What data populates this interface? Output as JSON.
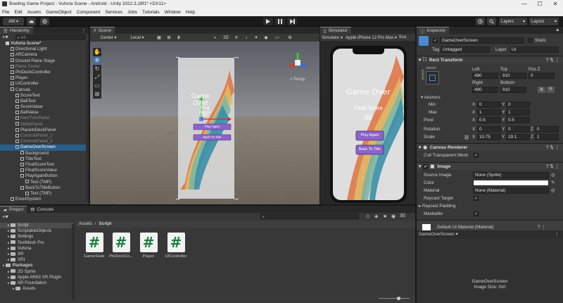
{
  "window": {
    "title": "Bowling Game Project - Vuforia Scene - Android - Unity 2022.3.28f1* <DX11>",
    "controls": [
      "—",
      "☐",
      "✕"
    ]
  },
  "menu": [
    "File",
    "Edit",
    "Assets",
    "GameObject",
    "Component",
    "Services",
    "Jobs",
    "Tutorials",
    "Window",
    "Help"
  ],
  "toolbar": {
    "account": "AW ▾",
    "layers": "Layers",
    "layout": "Layout"
  },
  "hierarchy": {
    "tab": "Hierarchy",
    "search_placeholder": "All",
    "items": [
      {
        "label": "Vuforia Scene*",
        "indent": 0,
        "style": "bold"
      },
      {
        "label": "Directional Light",
        "indent": 1
      },
      {
        "label": "ARCamera",
        "indent": 1
      },
      {
        "label": "Ground Plane Stage",
        "indent": 1
      },
      {
        "label": "Plane Finder",
        "indent": 1,
        "style": "dim"
      },
      {
        "label": "PinDeckController",
        "indent": 1
      },
      {
        "label": "Player",
        "indent": 1
      },
      {
        "label": "UIController",
        "indent": 1
      },
      {
        "label": "Canvas",
        "indent": 1
      },
      {
        "label": "ScoreText",
        "indent": 2
      },
      {
        "label": "BallText",
        "indent": 2
      },
      {
        "label": "ScoreValue",
        "indent": 2
      },
      {
        "label": "BallValue",
        "indent": 2
      },
      {
        "label": "NextTurnPanel",
        "indent": 2,
        "style": "dim"
      },
      {
        "label": "StrikePanel",
        "indent": 2,
        "style": "dim"
      },
      {
        "label": "PlaceInDeckPanel",
        "indent": 2
      },
      {
        "label": "ControlsPanel_1",
        "indent": 2,
        "style": "dim"
      },
      {
        "label": "ControlsPanel_2",
        "indent": 2,
        "style": "dim"
      },
      {
        "label": "GameOverScreen",
        "indent": 2,
        "style": "sel"
      },
      {
        "label": "Background",
        "indent": 3
      },
      {
        "label": "TitleText",
        "indent": 3
      },
      {
        "label": "FinalScoreText",
        "indent": 3
      },
      {
        "label": "FinalScoreValue",
        "indent": 3
      },
      {
        "label": "PlayAgainButton",
        "indent": 3
      },
      {
        "label": "Text (TMP)",
        "indent": 4
      },
      {
        "label": "BackToTitleButton",
        "indent": 3
      },
      {
        "label": "Text (TMP)",
        "indent": 4
      },
      {
        "label": "EventSystem",
        "indent": 1
      }
    ]
  },
  "scene": {
    "tab": "Scene",
    "pivot": "Center",
    "space": "Local",
    "mode_2d": "2D",
    "persp": "< Persp",
    "canvas_title": "Game Over",
    "final_score": "Final Score",
    "score_value": "00",
    "play_again": "Play Again",
    "back_to_title": "Back To Title"
  },
  "simulator": {
    "tab": "Simulator",
    "mode": "Simulator ▾",
    "device": "Apple iPhone 12 Pro Max ▾",
    "scale": "Sca",
    "title": "Game Over",
    "final_score": "Final Score",
    "score_value": "00",
    "play_again": "Play Again",
    "back_to_title": "Back To Title"
  },
  "inspector": {
    "tab": "Inspector",
    "object_name": "GameOverScreen",
    "static_label": "Static",
    "tag_label": "Tag",
    "tag_value": "Untagged",
    "layer_label": "Layer",
    "layer_value": "UI",
    "rect_transform": "Rect Transform",
    "stretch": "stretch",
    "left_label": "Left",
    "left_value": "490",
    "top_label": "Top",
    "top_value": "910",
    "posz_label": "Pos Z",
    "posz_value": "0",
    "right_label": "Right",
    "right_value": "490",
    "bottom_label": "Bottom",
    "bottom_value": "910",
    "r_btn": "R",
    "anchors": "Anchors",
    "min_label": "Min",
    "min_x": "0",
    "min_y": "0",
    "max_label": "Max",
    "max_x": "1",
    "max_y": "1",
    "pivot_label": "Pivot",
    "pivot_x": "0.5",
    "pivot_y": "0.5",
    "rotation_label": "Rotation",
    "rot_x": "0",
    "rot_y": "0",
    "rot_z": "0",
    "scale_label": "Scale",
    "scale_x": "10.75",
    "scale_y": "19.1",
    "scale_z": "1",
    "x_label": "X",
    "y_label": "Y",
    "z_label": "Z",
    "canvas_renderer": "Canvas Renderer",
    "cull_label": "Cull Transparent Mesh",
    "image": "Image",
    "source_image_label": "Source Image",
    "source_image_value": "None (Sprite)",
    "color_label": "Color",
    "material_label": "Material",
    "material_value": "None (Material)",
    "raycast_target_label": "Raycast Target",
    "raycast_padding_label": "Raycast Padding",
    "maskable_label": "Maskable",
    "default_material": "Default UI Material (Material)",
    "footer_object": "GameOverScreen ▾",
    "preview_title": "GameOverScreen",
    "preview_size": "Image Size: 0x0"
  },
  "project": {
    "tab_project": "Project",
    "tab_console": "Console",
    "breadcrumb_root": "Assets",
    "breadcrumb_sep": "›",
    "breadcrumb_leaf": "Script",
    "count": "30",
    "tree": [
      {
        "label": "Script",
        "indent": 1,
        "style": "sel"
      },
      {
        "label": "ScriptableObjects",
        "indent": 1
      },
      {
        "label": "Settings",
        "indent": 1
      },
      {
        "label": "TextMesh Pro",
        "indent": 1
      },
      {
        "label": "Vuforia",
        "indent": 1
      },
      {
        "label": "XR",
        "indent": 1
      },
      {
        "label": "XRI",
        "indent": 1
      },
      {
        "label": "Packages",
        "indent": 0,
        "style": "bold"
      },
      {
        "label": "2D Sprite",
        "indent": 1
      },
      {
        "label": "Apple ARKit XR Plugin",
        "indent": 1
      },
      {
        "label": "AR Foundation",
        "indent": 1
      },
      {
        "label": "Assets",
        "indent": 2
      }
    ],
    "assets": [
      "GameState",
      "PinDeckCo...",
      "Player",
      "UIController"
    ],
    "asset_glyph": "#"
  },
  "colors": {
    "selection": "#2c5d87",
    "panel": "#383838",
    "purple_button": "#8d63c9",
    "rainbow": [
      "#3c8fa8",
      "#7bb7a3",
      "#e1b866",
      "#e0713f"
    ]
  }
}
